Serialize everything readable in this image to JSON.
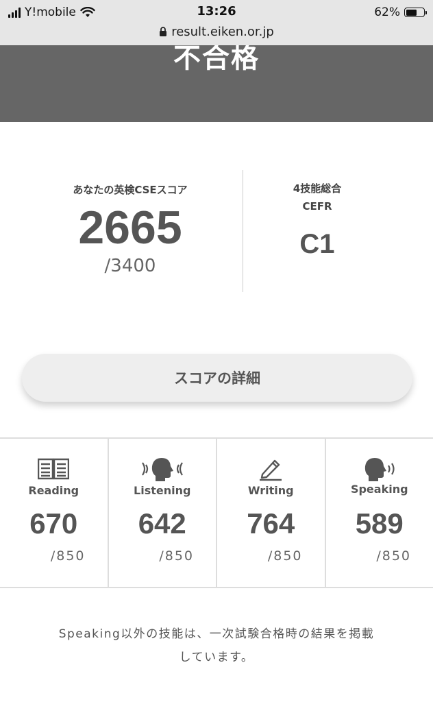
{
  "status_bar": {
    "carrier": "Y!mobile",
    "time": "13:26",
    "battery_text": "62%",
    "battery_level": 0.62,
    "url": "result.eiken.or.jp"
  },
  "result": {
    "title": "不合格"
  },
  "score": {
    "cse_label": "あなたの英検CSEスコア",
    "cse_value": "2665",
    "cse_max": "/3400",
    "cefr_label_line1": "4技能総合",
    "cefr_label_line2": "CEFR",
    "cefr_value": "C1"
  },
  "detail_button": {
    "label": "スコアの詳細"
  },
  "skills": [
    {
      "name": "Reading",
      "score": "670",
      "max": "/850",
      "icon": "book-icon"
    },
    {
      "name": "Listening",
      "score": "642",
      "max": "/850",
      "icon": "listening-icon"
    },
    {
      "name": "Writing",
      "score": "764",
      "max": "/850",
      "icon": "pencil-icon"
    },
    {
      "name": "Speaking",
      "score": "589",
      "max": "/850",
      "icon": "speaking-icon"
    }
  ],
  "note": {
    "line1": "Speaking以外の技能は、一次試験合格時の結果を掲載",
    "line2": "しています。"
  },
  "colors": {
    "banner": "#666666",
    "text": "#555555",
    "divider": "#dddddd",
    "button_bg": "#eeeeee"
  }
}
